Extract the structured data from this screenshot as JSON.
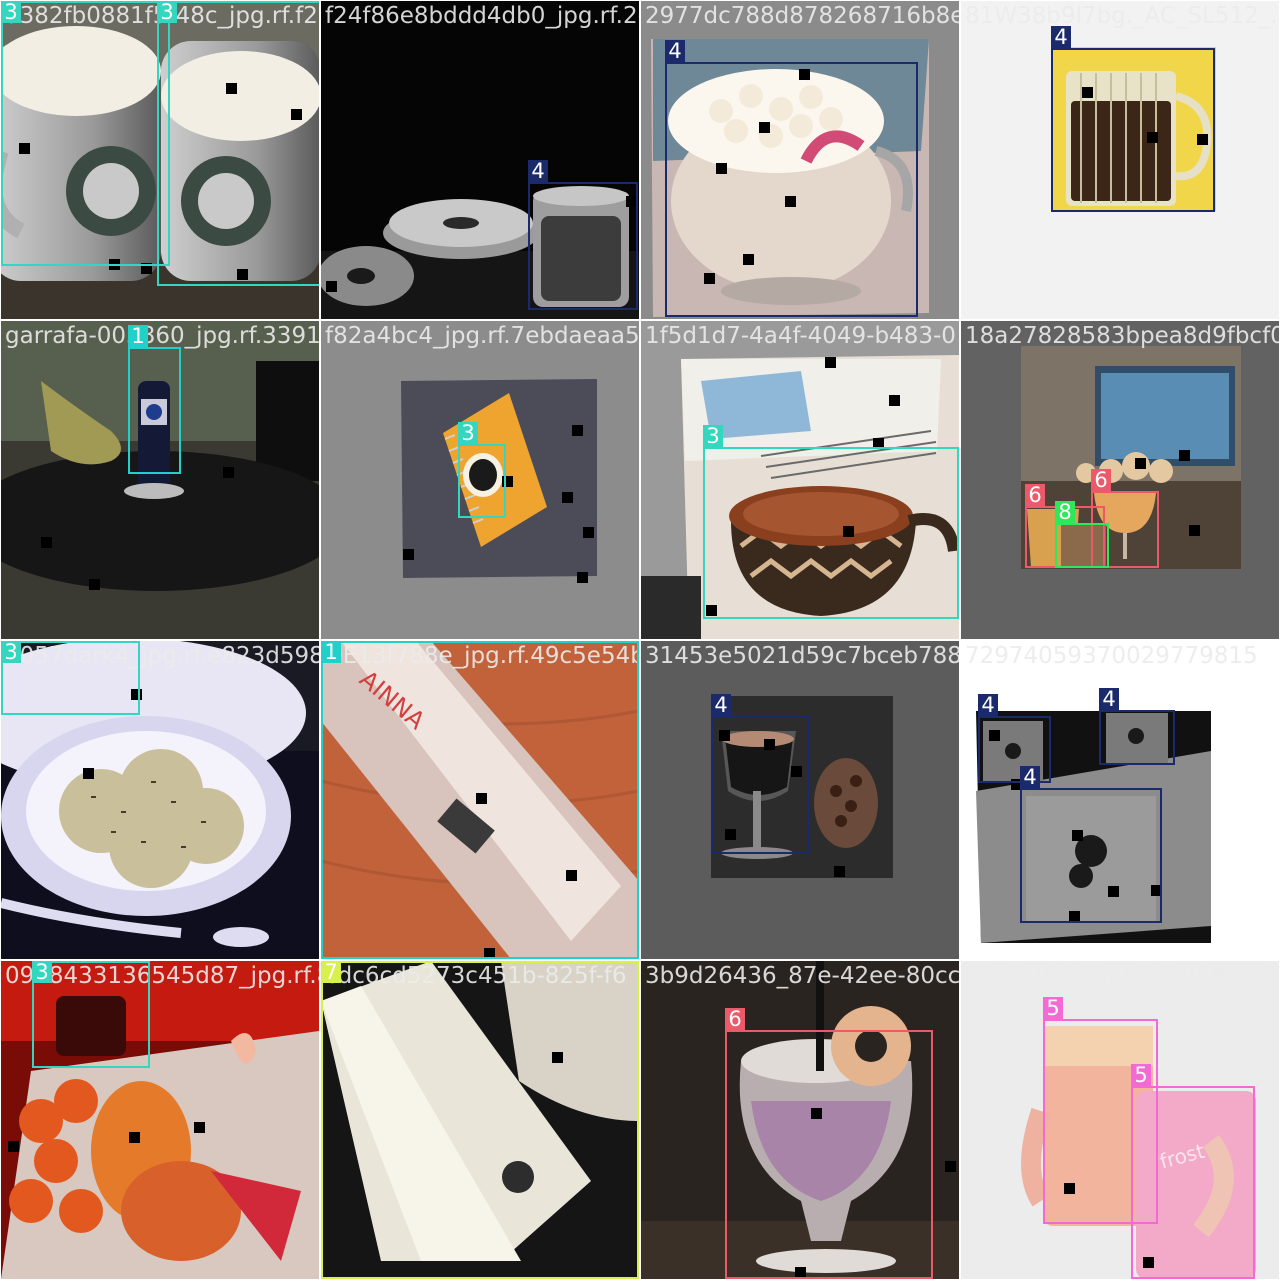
{
  "mosaic": {
    "class_colors": {
      "1": "#1fd1c8",
      "3": "#35d6c0",
      "4": "#1b2a6b",
      "5": "#f46ad4",
      "6": "#ec5a6a",
      "7": "#d8f04a",
      "8": "#2ee85a"
    },
    "tiles": [
      {
        "filename": "3382fb0881f5f48c_jpg.rf.f2",
        "scene": "mugs",
        "boxes": [
          {
            "label": "3"
          },
          {
            "label": "3"
          }
        ]
      },
      {
        "filename": "f24f86e8bddd4db0_jpg.rf.2e3649a7dbbcdf7c6a3",
        "scene": "donuts",
        "boxes": [
          {
            "label": "4"
          }
        ]
      },
      {
        "filename": "2977dc788d878268716b8e41dbd08f2_jpg.rf",
        "scene": "cocoa",
        "boxes": [
          {
            "label": "4"
          }
        ]
      },
      {
        "filename": "81W38b9l7bg._AC_SL512_.",
        "scene": "glass-mug",
        "boxes": [
          {
            "label": "4"
          }
        ]
      },
      {
        "filename": "garrafa-003860_jpg.rf.3391778219d08419",
        "scene": "bottle",
        "boxes": [
          {
            "label": "1"
          }
        ]
      },
      {
        "filename": "f82a4bc4_jpg.rf.7ebdaeaa591c0b5f842c56",
        "scene": "notebook",
        "boxes": [
          {
            "label": "3"
          }
        ]
      },
      {
        "filename": "1f5d1d7-4a4f-4049-b483-0",
        "scene": "basket-cup",
        "boxes": [
          {
            "label": "3"
          }
        ]
      },
      {
        "filename": "18a27828583bpea8d9fbcf0a",
        "scene": "cocktails",
        "boxes": [
          {
            "label": "6"
          },
          {
            "label": "6"
          },
          {
            "label": "8"
          }
        ]
      },
      {
        "filename": "2057dark4_jpg.rf.e823d5989b2",
        "scene": "ice-cream",
        "boxes": [
          {
            "label": "3"
          }
        ]
      },
      {
        "filename": "DE13f788e_jpg.rf.49c5e54b6188",
        "scene": "water-bottle",
        "boxes": [
          {
            "label": "1"
          }
        ]
      },
      {
        "filename": "31453e5021d59c7bceb78879240585_d0",
        "scene": "coffee-glass",
        "boxes": [
          {
            "label": "4"
          }
        ]
      },
      {
        "filename": "72974059370029779815",
        "scene": "floral-mugs",
        "boxes": [
          {
            "label": "4"
          },
          {
            "label": "4"
          },
          {
            "label": "4"
          }
        ]
      },
      {
        "filename": "0978433136545d87_jpg.rf.85988",
        "scene": "fruit",
        "boxes": [
          {
            "label": "3"
          }
        ]
      },
      {
        "filename": "cdc6cd5273c451b-825f-f6",
        "scene": "tumbler",
        "boxes": [
          {
            "label": "7"
          }
        ]
      },
      {
        "filename": "3b9d26436_87e-42ee-80cc-8",
        "scene": "drink",
        "boxes": [
          {
            "label": "6"
          }
        ]
      },
      {
        "filename": "a70c10d7aa26-4e80-801b-8e",
        "scene": "pink-drinks",
        "boxes": [
          {
            "label": "5"
          },
          {
            "label": "5"
          }
        ]
      }
    ]
  }
}
